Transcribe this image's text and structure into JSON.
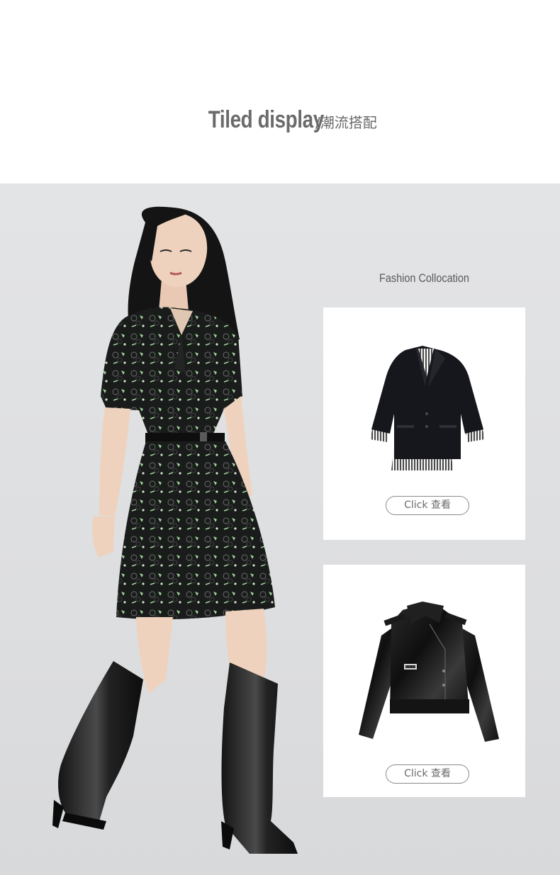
{
  "header": {
    "title_en": "Tiled  display",
    "separator": "/",
    "title_cn": "潮流搭配"
  },
  "section": {
    "label": "Fashion Collocation"
  },
  "products": [
    {
      "name": "black-blazer",
      "button_label": "Click 查看"
    },
    {
      "name": "black-leather-jacket",
      "button_label": "Click 查看"
    }
  ],
  "colors": {
    "title_gray": "#6b6b6b",
    "stage_bg": "#e3e4e6",
    "card_bg": "#ffffff",
    "dress_print": "#9fd59a"
  }
}
